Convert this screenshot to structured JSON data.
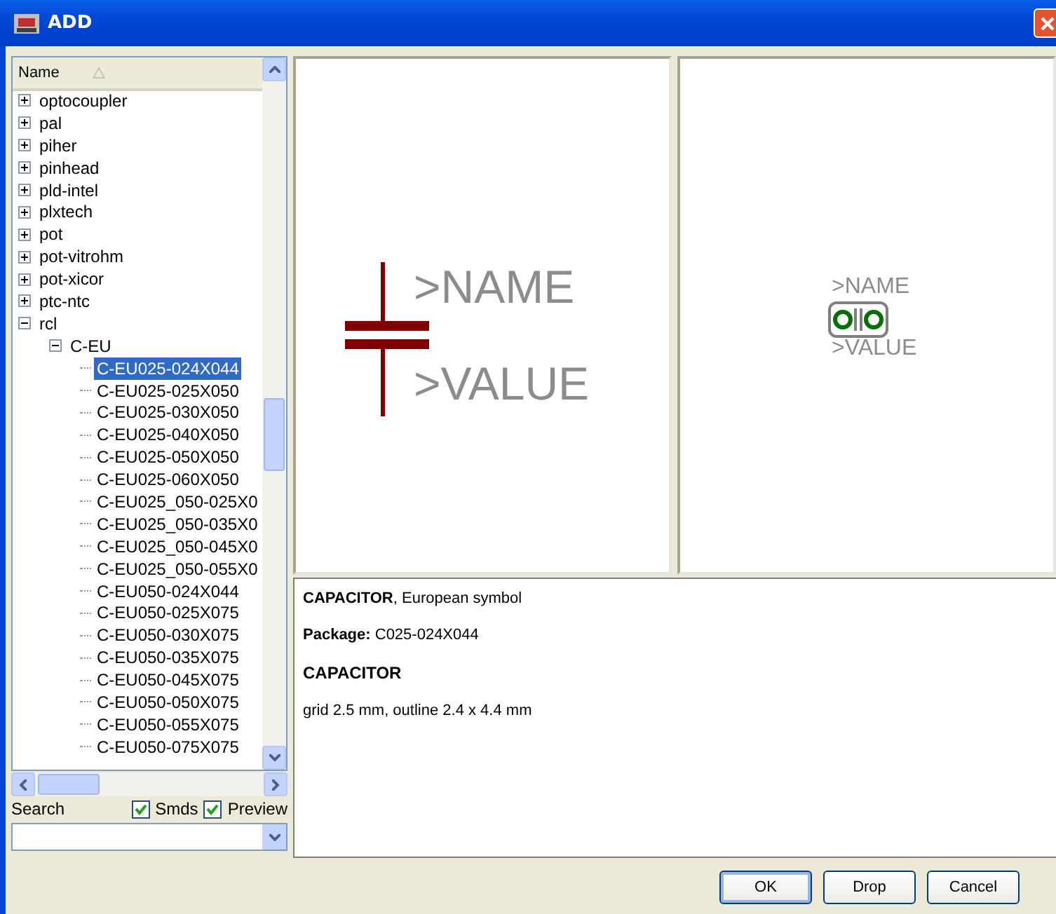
{
  "window": {
    "title": "ADD"
  },
  "tree": {
    "column": "Name",
    "items": [
      {
        "label": "optocoupler",
        "selected": false,
        "expanded": false
      },
      {
        "label": "pal",
        "selected": false,
        "expanded": false
      },
      {
        "label": "piher",
        "selected": false,
        "expanded": false
      },
      {
        "label": "pinhead",
        "selected": false,
        "expanded": false
      },
      {
        "label": "pld-intel",
        "selected": false,
        "expanded": false
      },
      {
        "label": "plxtech",
        "selected": false,
        "expanded": false
      },
      {
        "label": "pot",
        "selected": false,
        "expanded": false
      },
      {
        "label": "pot-vitrohm",
        "selected": false,
        "expanded": false
      },
      {
        "label": "pot-xicor",
        "selected": false,
        "expanded": false
      },
      {
        "label": "ptc-ntc",
        "selected": false,
        "expanded": false
      },
      {
        "label": "rcl",
        "selected": false,
        "expanded": true,
        "children": [
          {
            "label": "C-EU",
            "selected": false,
            "expanded": true,
            "children": [
              {
                "label": "C-EU025-024X044",
                "selected": true
              },
              {
                "label": "C-EU025-025X050",
                "selected": false
              },
              {
                "label": "C-EU025-030X050",
                "selected": false
              },
              {
                "label": "C-EU025-040X050",
                "selected": false
              },
              {
                "label": "C-EU025-050X050",
                "selected": false
              },
              {
                "label": "C-EU025-060X050",
                "selected": false
              },
              {
                "label": "C-EU025_050-025X0",
                "selected": false
              },
              {
                "label": "C-EU025_050-035X0",
                "selected": false
              },
              {
                "label": "C-EU025_050-045X0",
                "selected": false
              },
              {
                "label": "C-EU025_050-055X0",
                "selected": false
              },
              {
                "label": "C-EU050-024X044",
                "selected": false
              },
              {
                "label": "C-EU050-025X075",
                "selected": false
              },
              {
                "label": "C-EU050-030X075",
                "selected": false
              },
              {
                "label": "C-EU050-035X075",
                "selected": false
              },
              {
                "label": "C-EU050-045X075",
                "selected": false
              },
              {
                "label": "C-EU050-050X075",
                "selected": false
              },
              {
                "label": "C-EU050-055X075",
                "selected": false
              },
              {
                "label": "C-EU050-075X075",
                "selected": false
              }
            ]
          }
        ]
      }
    ]
  },
  "search": {
    "label": "Search"
  },
  "options": [
    {
      "label": "Smds",
      "checked": true
    },
    {
      "label": "Preview",
      "checked": true
    }
  ],
  "symbol_preview": {
    "name": ">NAME",
    "value": ">VALUE"
  },
  "package_preview": {
    "name": ">NAME",
    "value": ">VALUE"
  },
  "description": [
    {
      "kind": "text",
      "text": "**CAPACITOR**, European symbol"
    },
    {
      "kind": "text",
      "text": "**Package:** C025-024X044"
    },
    {
      "kind": "heading",
      "text": "CAPACITOR"
    },
    {
      "kind": "text",
      "text": "grid 2.5 mm, outline 2.4 x 4.4 mm"
    }
  ],
  "buttons": [
    {
      "label": "OK",
      "default": true
    },
    {
      "label": "Drop",
      "default": false
    },
    {
      "label": "Cancel",
      "default": false
    }
  ]
}
